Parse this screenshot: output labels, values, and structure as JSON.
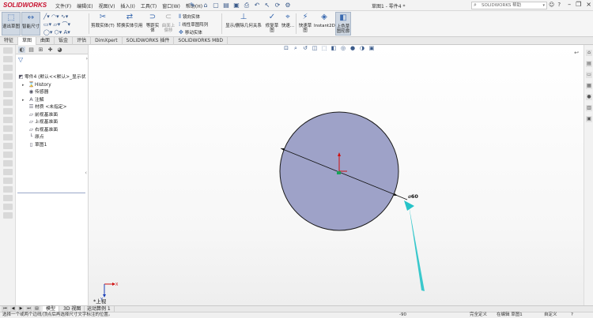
{
  "app": {
    "logo": "SOLIDWORKS"
  },
  "menu": [
    "文件(F)",
    "编辑(E)",
    "视图(V)",
    "插入(I)",
    "工具(T)",
    "窗口(W)",
    "帮助(H)"
  ],
  "title": "草图1 - 零件4 *",
  "help_search": {
    "placeholder": "SOLIDWORKS 帮助"
  },
  "ribbon": {
    "exit_sketch": "退出草图",
    "smart_dimension": "智能尺寸",
    "trim_entities": "剪裁实体(T)",
    "convert_entities": "转换实体引用",
    "offset_entities": "等距实体",
    "offset_surface": "曲面上偏移",
    "mirror_entities": "镜向实体",
    "linear_pattern": "线性草图阵列",
    "move_entities": "移动实体",
    "display_relations": "显示/删除几何关系",
    "repair_sketch": "修复草图",
    "quick_snaps": "快速...",
    "rapid_sketch": "快速草图",
    "instant2d": "Instant2D",
    "shaded_sketch": "上色草图轮廓"
  },
  "tabs": [
    "特征",
    "草图",
    "曲面",
    "钣金",
    "评估",
    "DimXpert",
    "SOLIDWORKS 插件",
    "SOLIDWORKS MBD"
  ],
  "active_tab": "草图",
  "tree": {
    "root": "零件4 (默认<<默认>_显示状",
    "items": [
      "History",
      "传感器",
      "注解",
      "材质 <未指定>",
      "前视基准面",
      "上视基准面",
      "右视基准面",
      "原点",
      "草图1"
    ]
  },
  "canvas": {
    "dimension_text": "⌀60",
    "view_label": "*上视",
    "axis_x": "X",
    "axis_y": "Y"
  },
  "bottom_tabs": [
    "模型",
    "3D 视图",
    "运动算例 1"
  ],
  "active_bottom_tab": "模型",
  "status": {
    "message": "选择一个或两个边线/顶点后再选择尺寸文字标注的位置。",
    "angle": "-90",
    "defined": "完全定义",
    "editing": "在编辑 草图1",
    "units": "自定义"
  }
}
